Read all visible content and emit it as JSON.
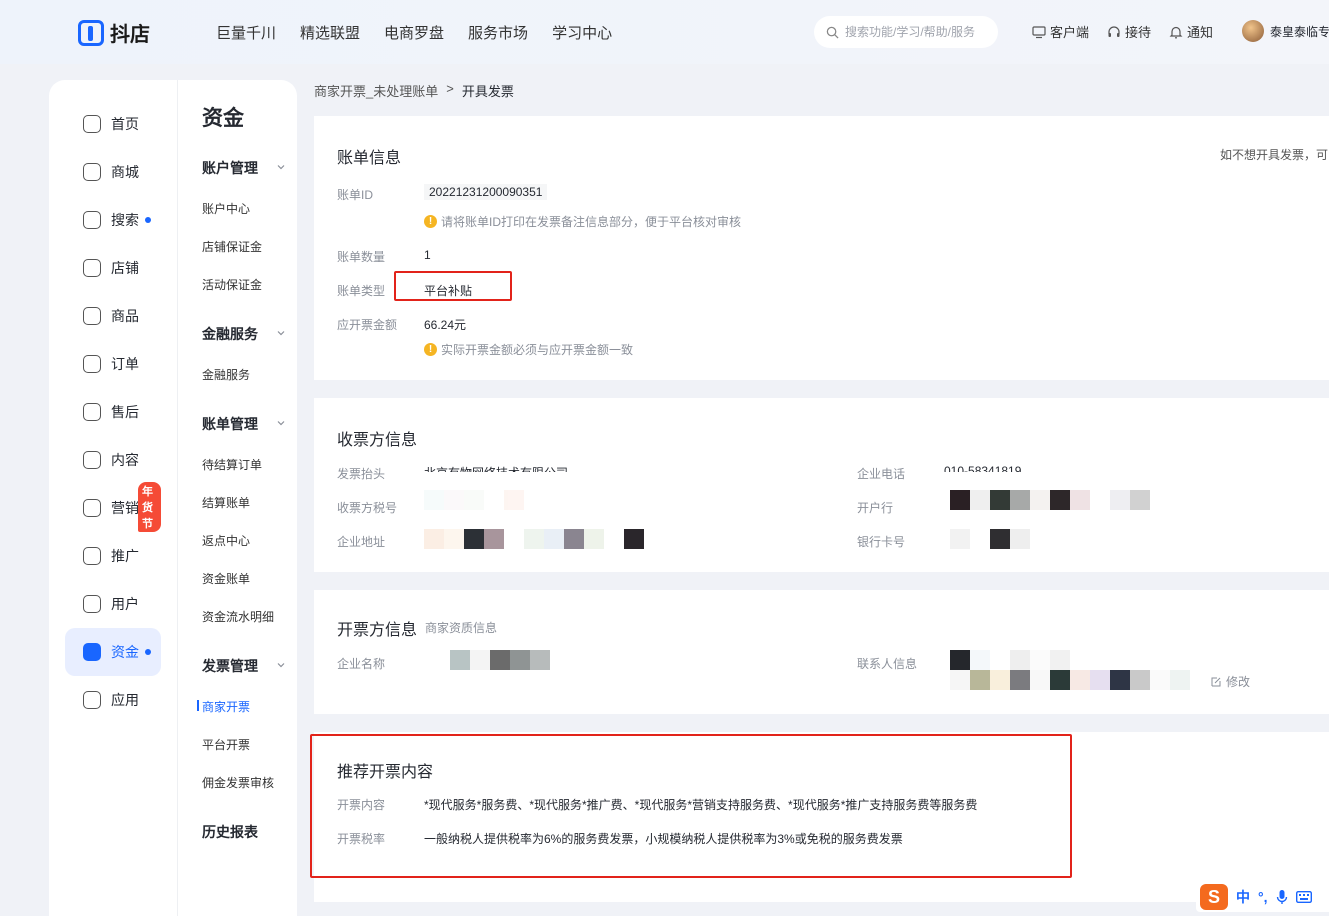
{
  "brand": {
    "name": "抖店"
  },
  "topnav": [
    "巨量千川",
    "精选联盟",
    "电商罗盘",
    "服务市场",
    "学习中心"
  ],
  "search": {
    "placeholder": "搜索功能/学习/帮助/服务"
  },
  "top_actions": {
    "client": "客户端",
    "reception": "接待",
    "notify": "通知",
    "user": "泰皇泰临专"
  },
  "leftnav": [
    {
      "label": "首页",
      "icon": "home-icon"
    },
    {
      "label": "商城",
      "icon": "mall-icon"
    },
    {
      "label": "搜索",
      "icon": "search-data-icon",
      "dot": true
    },
    {
      "label": "店铺",
      "icon": "shop-icon"
    },
    {
      "label": "商品",
      "icon": "goods-icon"
    },
    {
      "label": "订单",
      "icon": "order-icon"
    },
    {
      "label": "售后",
      "icon": "aftersale-icon"
    },
    {
      "label": "内容",
      "icon": "content-icon"
    },
    {
      "label": "营销",
      "icon": "marketing-icon",
      "badge": "年货节"
    },
    {
      "label": "推广",
      "icon": "promotion-icon"
    },
    {
      "label": "用户",
      "icon": "user-icon"
    },
    {
      "label": "资金",
      "icon": "funds-icon",
      "active": true,
      "dot": true
    },
    {
      "label": "应用",
      "icon": "app-icon"
    }
  ],
  "subnav": {
    "title": "资金",
    "groups": [
      {
        "label": "账户管理",
        "items": [
          "账户中心",
          "店铺保证金",
          "活动保证金"
        ]
      },
      {
        "label": "金融服务",
        "items": [
          "金融服务"
        ]
      },
      {
        "label": "账单管理",
        "items": [
          "待结算订单",
          "结算账单",
          "返点中心",
          "资金账单",
          "资金流水明细"
        ]
      },
      {
        "label": "发票管理",
        "items": [
          "商家开票",
          "平台开票",
          "佣金发票审核"
        ]
      },
      {
        "label": "历史报表",
        "items": []
      }
    ],
    "active_item": "商家开票"
  },
  "breadcrumb": {
    "parent": "商家开票_未处理账单",
    "sep": ">",
    "current": "开具发票"
  },
  "bill_info": {
    "title": "账单信息",
    "right_note": "如不想开具发票，可",
    "id_label": "账单ID",
    "id_value": "20221231200090351",
    "id_tip": "请将账单ID打印在发票备注信息部分，便于平台核对审核",
    "count_label": "账单数量",
    "count_value": "1",
    "type_label": "账单类型",
    "type_value": "平台补贴",
    "amount_label": "应开票金额",
    "amount_value": "66.24元",
    "amount_tip": "实际开票金额必须与应开票金额一致"
  },
  "receiver": {
    "title": "收票方信息",
    "header_label": "发票抬头",
    "header_value": "北京有物网络技术有限公司",
    "tax_label": "收票方税号",
    "address_label": "企业地址",
    "phone_label": "企业电话",
    "phone_value": "010-58341819",
    "bank_label": "开户行",
    "card_label": "银行卡号"
  },
  "issuer": {
    "title": "开票方信息",
    "subtitle": "商家资质信息",
    "company_label": "企业名称",
    "contact_label": "联系人信息",
    "edit_label": "修改"
  },
  "recommend": {
    "title": "推荐开票内容",
    "content_label": "开票内容",
    "content_value": "*现代服务*服务费、*现代服务*推广费、*现代服务*营销支持服务费、*现代服务*推广支持服务费等服务费",
    "rate_label": "开票税率",
    "rate_value": "一般纳税人提供税率为6%的服务费发票，小规模纳税人提供税率为3%或免税的服务费发票"
  },
  "ime": {
    "lang": "中",
    "punct": "°,"
  }
}
